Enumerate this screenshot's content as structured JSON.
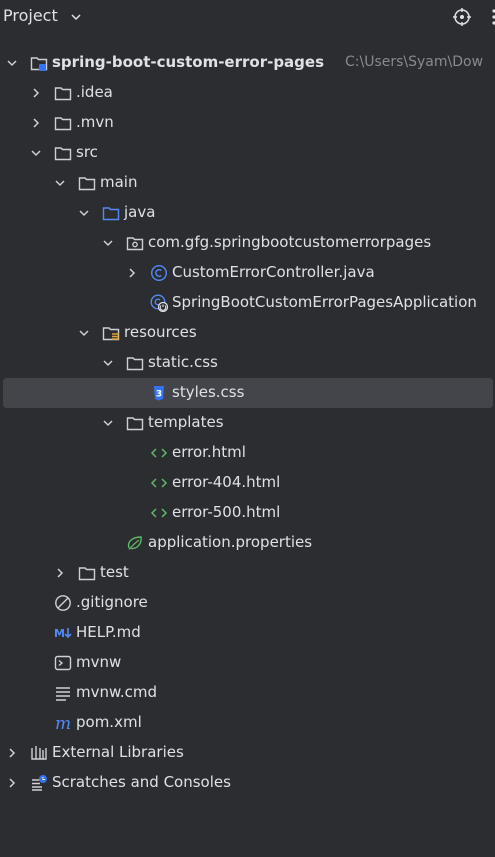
{
  "panel": {
    "title": "Project",
    "icons": {
      "dropdown": "chevron-down-icon",
      "locate": "crosshair-icon",
      "options": "more-icon"
    }
  },
  "tree": [
    {
      "label": "spring-boot-custom-error-pages",
      "path": "C:\\Users\\Syam\\Dow",
      "icon": "module-folder-icon",
      "expanded": true,
      "level": 0
    },
    {
      "label": ".idea",
      "icon": "folder-icon",
      "expanded": false,
      "level": 1
    },
    {
      "label": ".mvn",
      "icon": "folder-icon",
      "expanded": false,
      "level": 1
    },
    {
      "label": "src",
      "icon": "folder-icon",
      "expanded": true,
      "level": 1
    },
    {
      "label": "main",
      "icon": "folder-icon",
      "expanded": true,
      "level": 2
    },
    {
      "label": "java",
      "icon": "source-folder-icon",
      "expanded": true,
      "level": 3
    },
    {
      "label": "com.gfg.springbootcustomerrorpages",
      "icon": "package-icon",
      "expanded": true,
      "level": 4
    },
    {
      "label": "CustomErrorController.java",
      "icon": "class-icon",
      "expanded": false,
      "level": 5
    },
    {
      "label": "SpringBootCustomErrorPagesApplication",
      "icon": "spring-boot-class-icon",
      "level": 5
    },
    {
      "label": "resources",
      "icon": "resources-folder-icon",
      "expanded": true,
      "level": 3
    },
    {
      "label": "static.css",
      "icon": "folder-icon",
      "expanded": true,
      "level": 4
    },
    {
      "label": "styles.css",
      "icon": "css-file-icon",
      "level": 5,
      "selected": true
    },
    {
      "label": "templates",
      "icon": "folder-icon",
      "expanded": true,
      "level": 4
    },
    {
      "label": "error.html",
      "icon": "html-file-icon",
      "level": 5
    },
    {
      "label": "error-404.html",
      "icon": "html-file-icon",
      "level": 5
    },
    {
      "label": "error-500.html",
      "icon": "html-file-icon",
      "level": 5
    },
    {
      "label": "application.properties",
      "icon": "spring-properties-icon",
      "level": 4
    },
    {
      "label": "test",
      "icon": "folder-icon",
      "expanded": false,
      "level": 2
    },
    {
      "label": ".gitignore",
      "icon": "ignore-file-icon",
      "level": 1
    },
    {
      "label": "HELP.md",
      "icon": "markdown-file-icon",
      "level": 1
    },
    {
      "label": "mvnw",
      "icon": "terminal-file-icon",
      "level": 1
    },
    {
      "label": "mvnw.cmd",
      "icon": "text-file-icon",
      "level": 1
    },
    {
      "label": "pom.xml",
      "icon": "maven-file-icon",
      "level": 1
    },
    {
      "label": "External Libraries",
      "icon": "libraries-icon",
      "expanded": false,
      "level": 0
    },
    {
      "label": "Scratches and Consoles",
      "icon": "scratches-icon",
      "expanded": false,
      "level": 0
    }
  ]
}
